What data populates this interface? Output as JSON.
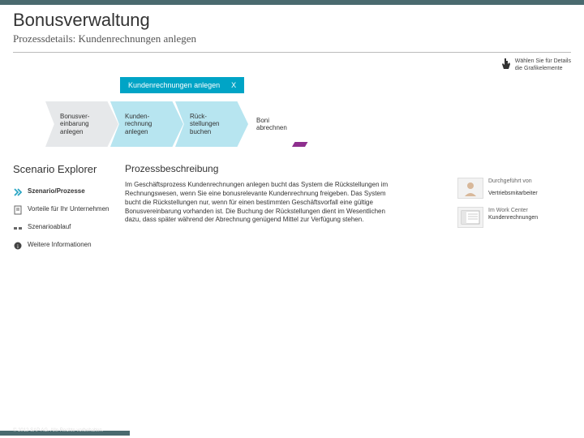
{
  "header": {
    "title": "Bonusverwaltung",
    "subtitle": "Prozessdetails: Kundenrechnungen anlegen"
  },
  "hint": {
    "line1": "Wählen Sie für Details",
    "line2": "die Grafikelemente"
  },
  "panel": {
    "title": "Kundenrechnungen anlegen",
    "close": "X"
  },
  "flow": {
    "steps": [
      {
        "label": "Bonusver-\neinbarung\nanlegen"
      },
      {
        "label": "Kunden-\nrechnung\nanlegen"
      },
      {
        "label": "Rück-\nstellungen\nbuchen"
      }
    ],
    "post": "Boni\nabrechnen"
  },
  "explorer": {
    "heading": "Scenario Explorer",
    "items": [
      {
        "label": "Szenario/Prozesse",
        "current": true
      },
      {
        "label": "Vorteile für Ihr Unternehmen",
        "current": false
      },
      {
        "label": "Szenarioablauf",
        "current": false
      },
      {
        "label": "Weitere Informationen",
        "current": false
      }
    ]
  },
  "description": {
    "heading": "Prozessbeschreibung",
    "body": "Im Geschäftsprozess Kundenrechnungen anlegen bucht das System die Rückstellungen im Rechnungswesen, wenn Sie eine bonusrelevante Kundenrechnung freigeben. Das System bucht die Rückstellungen nur, wenn für einen bestimmten Geschäftsvorfall eine gültige Bonusvereinbarung vorhanden ist. Die Buchung der Rückstellungen dient im Wesentlichen dazu, dass später während der Abrechnung genügend Mittel zur Verfügung stehen."
  },
  "meta": {
    "performedBy": {
      "label": "Durchgeführt von",
      "value": "Vertriebsmitarbeiter"
    },
    "workCenter": {
      "label": "Im Work Center",
      "value": "Kundenrechnungen"
    }
  },
  "footer": "© 2012 SAP AG. Alle Rechte vorbehalten."
}
